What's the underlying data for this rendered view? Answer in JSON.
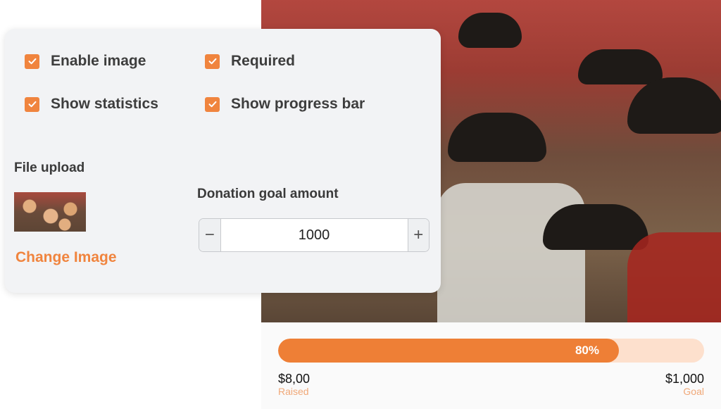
{
  "settings": {
    "checkboxes": [
      {
        "label": "Enable image",
        "checked": true
      },
      {
        "label": "Required",
        "checked": true
      },
      {
        "label": "Show statistics",
        "checked": true
      },
      {
        "label": "Show progress bar",
        "checked": true
      }
    ],
    "file_upload_label": "File upload",
    "change_image_label": "Change Image",
    "goal_label": "Donation goal amount",
    "goal_value": "1000",
    "minus_symbol": "−",
    "plus_symbol": "+"
  },
  "progress": {
    "percent": 80,
    "percent_label": "80%",
    "raised_amount": "$8,00",
    "raised_label": "Raised",
    "goal_amount": "$1,000",
    "goal_label": "Goal"
  },
  "colors": {
    "accent": "#f0843e",
    "track": "#fde0cd",
    "card_bg": "#f2f3f5"
  },
  "icons": {
    "checkbox": "checkmark-icon"
  }
}
